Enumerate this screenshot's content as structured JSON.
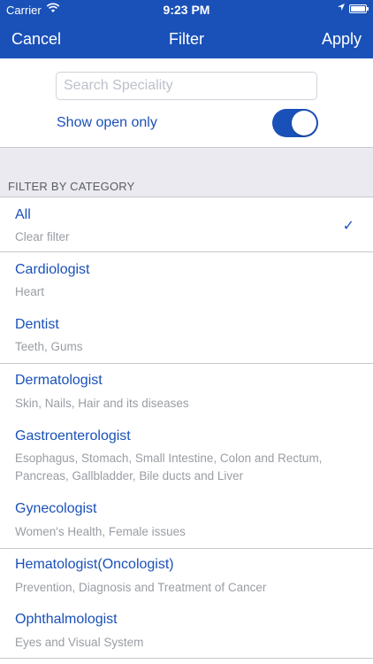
{
  "status_bar": {
    "carrier": "Carrier",
    "time": "9:23 PM"
  },
  "nav": {
    "cancel": "Cancel",
    "title": "Filter",
    "apply": "Apply"
  },
  "search": {
    "placeholder": "Search Speciality",
    "value": ""
  },
  "show_open": {
    "label": "Show open only",
    "enabled": true
  },
  "section_header": "FILTER BY CATEGORY",
  "categories": [
    {
      "title": "All",
      "subtitle": "Clear filter",
      "selected": true
    },
    {
      "title": "Cardiologist",
      "subtitle": "Heart"
    },
    {
      "title": "Dentist",
      "subtitle": "Teeth, Gums"
    },
    {
      "title": "Dermatologist",
      "subtitle": "Skin, Nails, Hair and its diseases"
    },
    {
      "title": "Gastroenterologist",
      "subtitle": "Esophagus, Stomach, Small Intestine, Colon and Rectum, Pancreas, Gallbladder, Bile ducts and Liver"
    },
    {
      "title": "Gynecologist",
      "subtitle": "Women's Health, Female issues"
    },
    {
      "title": "Hematologist(Oncologist)",
      "subtitle": "Prevention, Diagnosis and Treatment of Cancer"
    },
    {
      "title": "Ophthalmologist",
      "subtitle": "Eyes and Visual System"
    }
  ],
  "colors": {
    "accent": "#1a51b8",
    "section_bg": "#ebeaf0",
    "subtitle": "#9a9da4"
  }
}
